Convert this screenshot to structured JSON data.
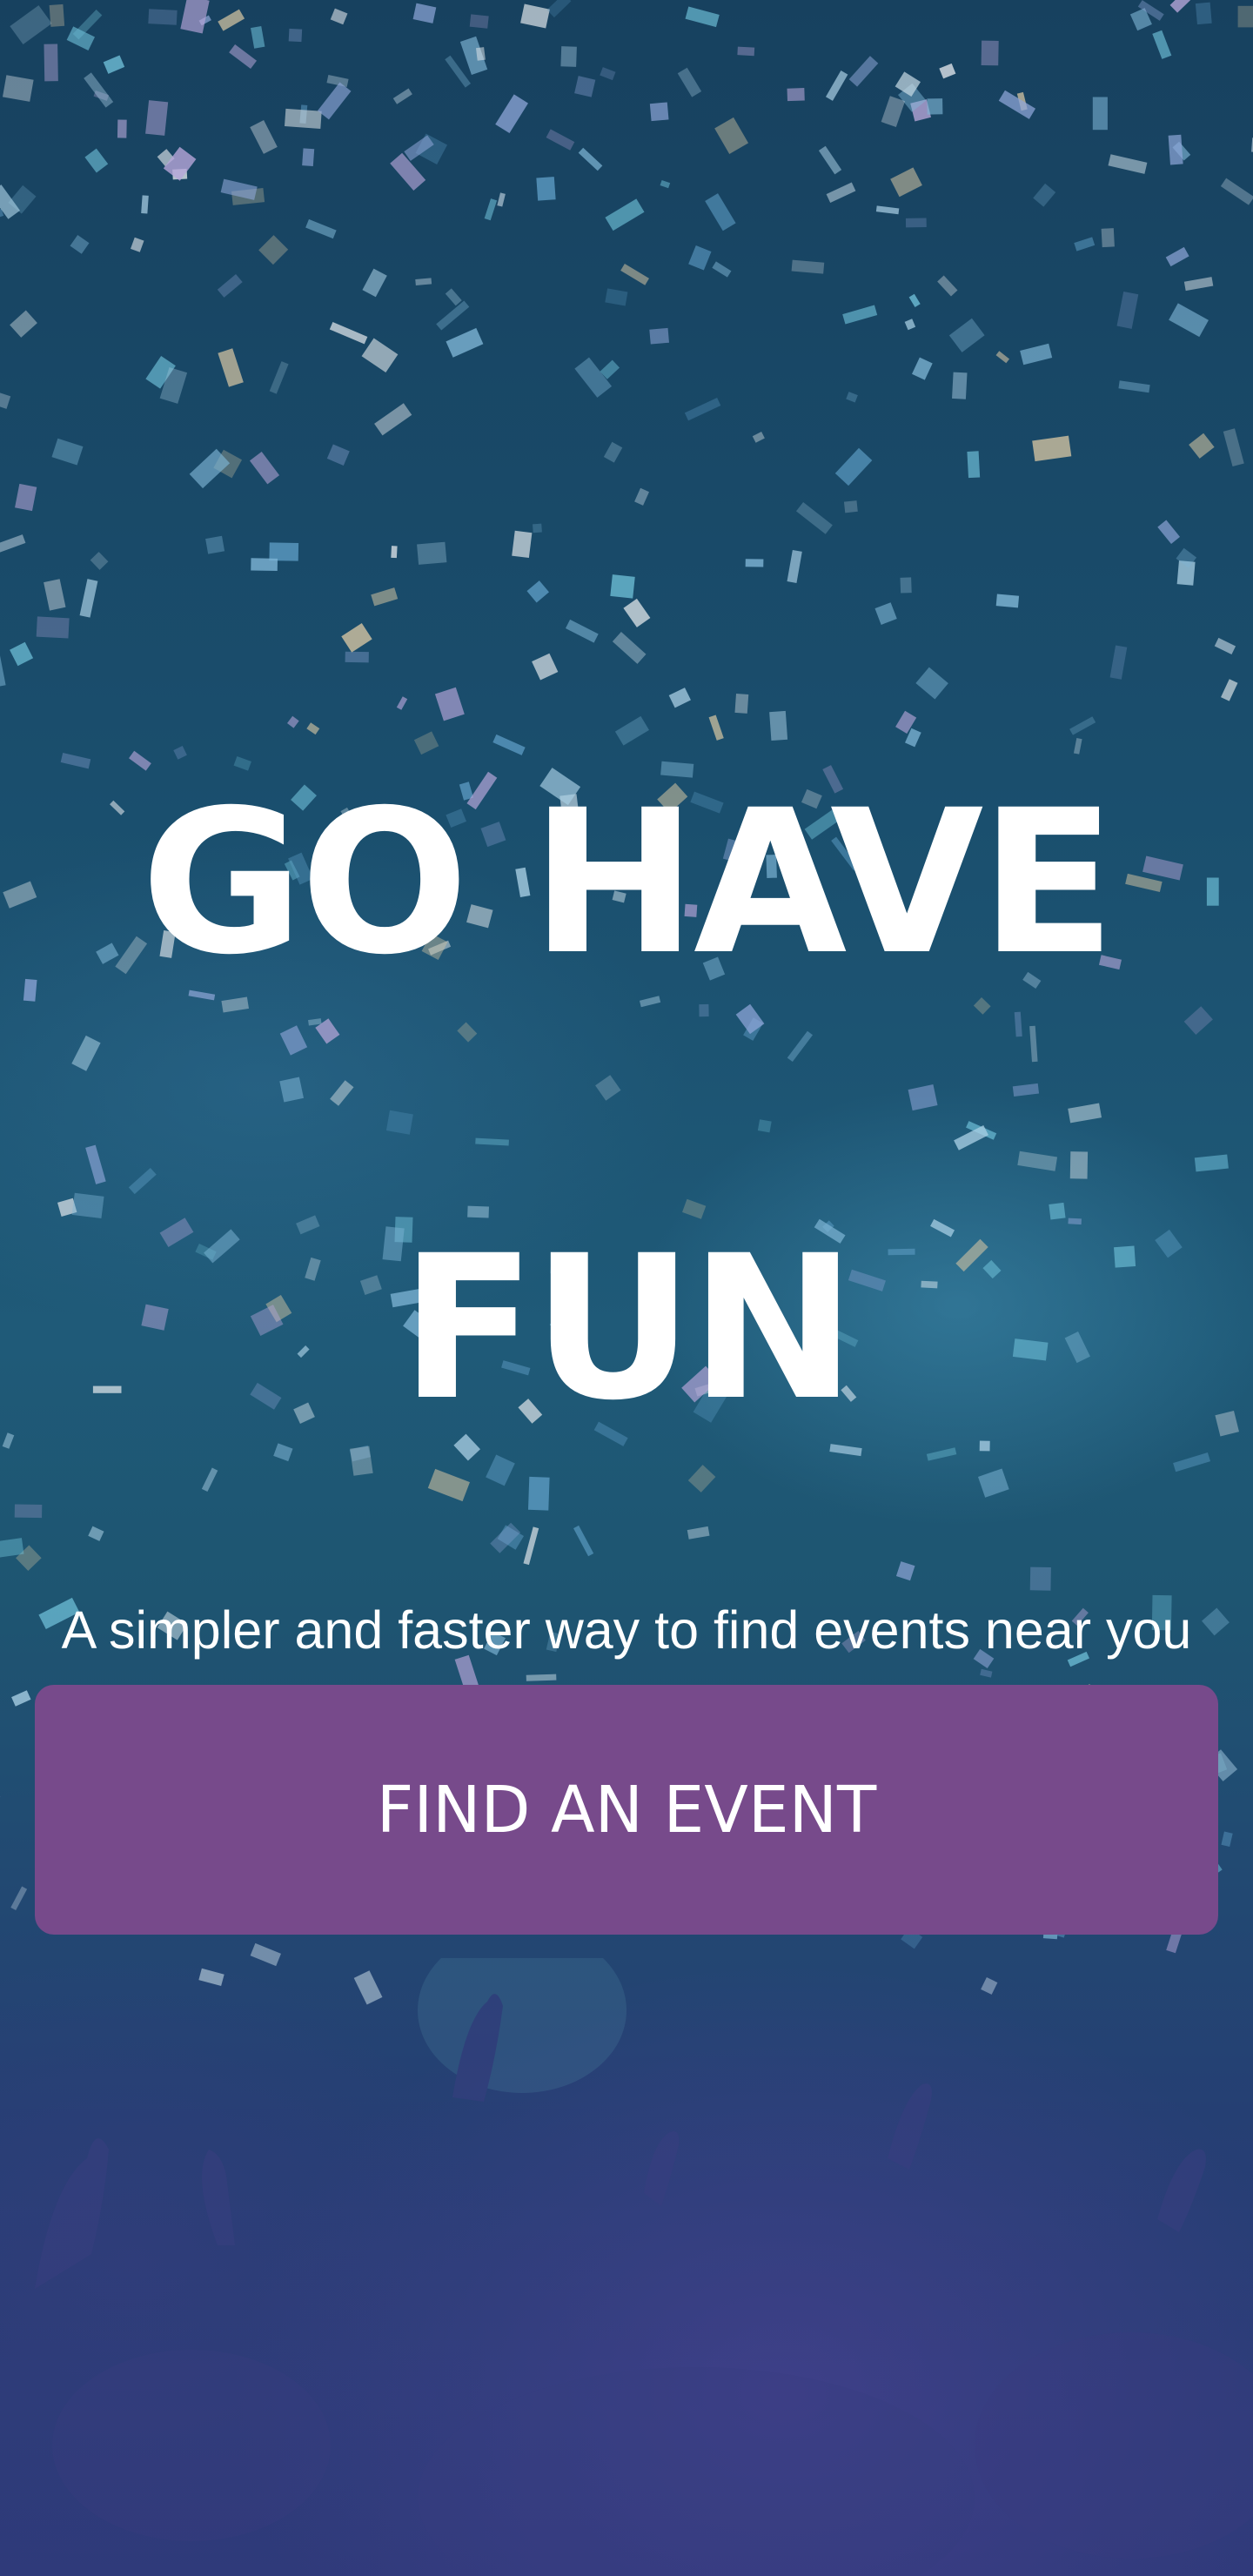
{
  "hero": {
    "headline_line_1": "GO HAVE",
    "headline_line_2": "FUN",
    "subtitle": "A simpler and faster way to find events near you"
  },
  "cta": {
    "label": "FIND AN EVENT"
  },
  "colors": {
    "button": "#774a8b",
    "background": "#1a4e6d",
    "text": "#ffffff"
  },
  "background_image": {
    "icon": "confetti-party-crowd-photo"
  }
}
